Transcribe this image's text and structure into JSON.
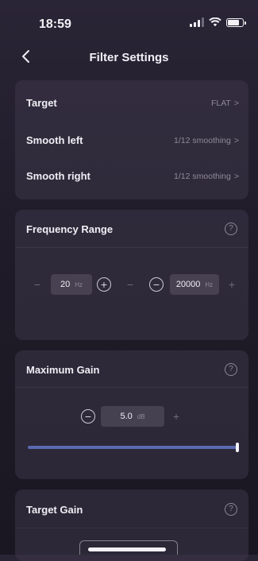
{
  "status_bar": {
    "time": "18:59"
  },
  "nav": {
    "title": "Filter Settings"
  },
  "settings": {
    "target": {
      "label": "Target",
      "value": "FLAT"
    },
    "smooth_left": {
      "label": "Smooth left",
      "value": "1/12 smoothing"
    },
    "smooth_right": {
      "label": "Smooth right",
      "value": "1/12 smoothing"
    }
  },
  "frequency_range": {
    "title": "Frequency Range",
    "min_value": "20",
    "max_value": "20000",
    "unit": "Hz"
  },
  "maximum_gain": {
    "title": "Maximum Gain",
    "value": "5.0",
    "unit": "dB",
    "slider_fraction": 1.0
  },
  "target_gain": {
    "title": "Target Gain"
  },
  "glyphs": {
    "chevron": ">",
    "help": "?",
    "minus": "−",
    "plus": "+"
  },
  "colors": {
    "slider": "#5a6ab0"
  }
}
